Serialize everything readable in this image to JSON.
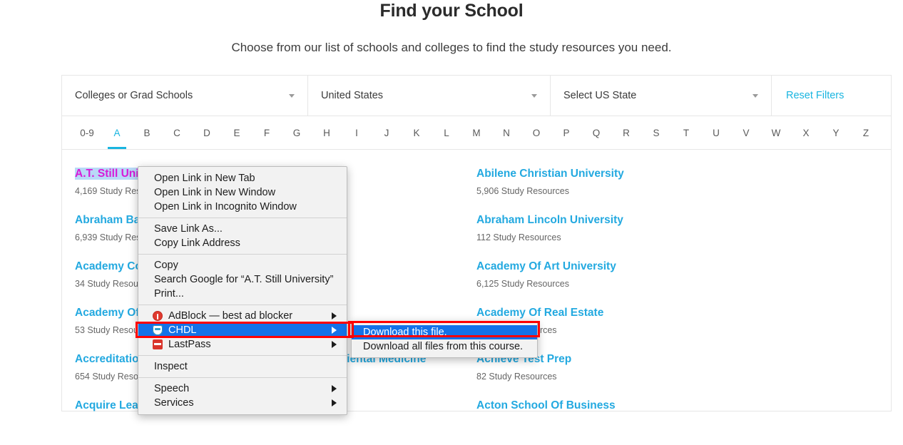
{
  "header": {
    "title": "Find your School",
    "subtitle": "Choose from our list of schools and colleges to find the study resources you need."
  },
  "filters": {
    "school_type": "Colleges or Grad Schools",
    "country": "United States",
    "state": "Select US State",
    "reset_label": "Reset Filters"
  },
  "alphabet": {
    "active": "A",
    "items": [
      "0-9",
      "A",
      "B",
      "C",
      "D",
      "E",
      "F",
      "G",
      "H",
      "I",
      "J",
      "K",
      "L",
      "M",
      "N",
      "O",
      "P",
      "Q",
      "R",
      "S",
      "T",
      "U",
      "V",
      "W",
      "X",
      "Y",
      "Z"
    ]
  },
  "schools": [
    {
      "name": "A.T. Still University",
      "count": "4,169 Study Resources",
      "selected": true
    },
    {
      "name": "Abilene Christian University",
      "count": "5,906 Study Resources",
      "selected": false
    },
    {
      "name": "Abraham Baldwin Agricultural College",
      "count": "6,939 Study Resources",
      "selected": false
    },
    {
      "name": "Abraham Lincoln University",
      "count": "112 Study Resources",
      "selected": false
    },
    {
      "name": "Academy College",
      "count": "34 Study Resources",
      "selected": false
    },
    {
      "name": "Academy Of Art University",
      "count": "6,125 Study Resources",
      "selected": false
    },
    {
      "name": "Academy Of Chinese Culture And Health Sciences",
      "count": "53 Study Resources",
      "selected": false
    },
    {
      "name": "Academy Of Real Estate",
      "count": "36 Study Resources",
      "selected": false
    },
    {
      "name": "Accreditation Commission For Acupuncture And Oriental Medicine",
      "count": "654 Study Resources",
      "selected": false
    },
    {
      "name": "Achieve Test Prep",
      "count": "82 Study Resources",
      "selected": false
    },
    {
      "name": "Acquire Learning",
      "count": "",
      "selected": false
    },
    {
      "name": "Acton School Of Business",
      "count": "",
      "selected": false
    }
  ],
  "context_menu": {
    "groups": [
      {
        "items": [
          {
            "label": "Open Link in New Tab",
            "icon": null,
            "arrow": false,
            "highlight": false
          },
          {
            "label": "Open Link in New Window",
            "icon": null,
            "arrow": false,
            "highlight": false
          },
          {
            "label": "Open Link in Incognito Window",
            "icon": null,
            "arrow": false,
            "highlight": false
          }
        ]
      },
      {
        "items": [
          {
            "label": "Save Link As...",
            "icon": null,
            "arrow": false,
            "highlight": false
          },
          {
            "label": "Copy Link Address",
            "icon": null,
            "arrow": false,
            "highlight": false
          }
        ]
      },
      {
        "items": [
          {
            "label": "Copy",
            "icon": null,
            "arrow": false,
            "highlight": false
          },
          {
            "label": "Search Google for “A.T. Still University”",
            "icon": null,
            "arrow": false,
            "highlight": false
          },
          {
            "label": "Print...",
            "icon": null,
            "arrow": false,
            "highlight": false
          }
        ]
      },
      {
        "items": [
          {
            "label": "AdBlock — best ad blocker",
            "icon": "adblock-icon",
            "arrow": true,
            "highlight": false
          },
          {
            "label": "CHDL",
            "icon": "chdl-shield-icon",
            "arrow": true,
            "highlight": true
          },
          {
            "label": "LastPass",
            "icon": "lastpass-icon",
            "arrow": true,
            "highlight": false
          }
        ]
      },
      {
        "items": [
          {
            "label": "Inspect",
            "icon": null,
            "arrow": false,
            "highlight": false
          }
        ]
      },
      {
        "items": [
          {
            "label": "Speech",
            "icon": null,
            "arrow": true,
            "highlight": false
          },
          {
            "label": "Services",
            "icon": null,
            "arrow": true,
            "highlight": false
          }
        ]
      }
    ]
  },
  "context_submenu": {
    "items": [
      {
        "label": "Download this file.",
        "highlight": true
      },
      {
        "label": "Download all files from this course.",
        "highlight": false
      }
    ]
  },
  "colors": {
    "accent": "#19b5e0",
    "link": "#23a9e0",
    "highlight": "#1472e8",
    "annotation": "#ff0000",
    "selection_text": "#d81ad8",
    "selection_bg": "#b9d9f7"
  }
}
